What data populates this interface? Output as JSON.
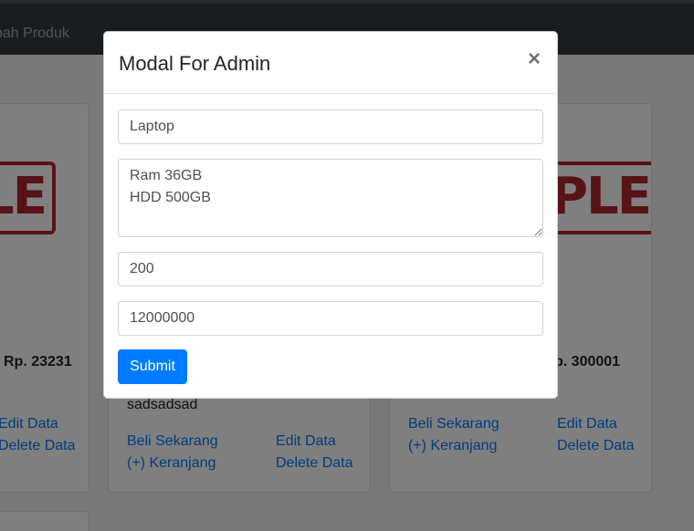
{
  "navbar": {
    "link_label": "bah Produk"
  },
  "cards": [
    {
      "image_text": "PLE",
      "price": "Rp. 23231",
      "buy_label": "",
      "cart_label": "",
      "edit_label": "Edit Data",
      "delete_label": "Delete Data"
    },
    {
      "description": "sadsadsad",
      "buy_label": "Beli Sekarang",
      "cart_label": "(+) Keranjang",
      "edit_label": "Edit Data",
      "delete_label": "Delete Data"
    },
    {
      "image_text": "PLE",
      "price": "p. 300001",
      "buy_label": "Beli Sekarang",
      "cart_label": "(+) Keranjang",
      "edit_label": "Edit Data",
      "delete_label": "Delete Data"
    }
  ],
  "modal": {
    "title": "Modal For Admin",
    "close_symbol": "×",
    "name_value": "Laptop",
    "description_value": "Ram 36GB\nHDD 500GB",
    "stock_value": "200",
    "price_value": "12000000",
    "submit_label": "Submit"
  },
  "colors": {
    "primary": "#007bff",
    "navbar": "#343a40",
    "sample_stamp": "#b0272d"
  }
}
